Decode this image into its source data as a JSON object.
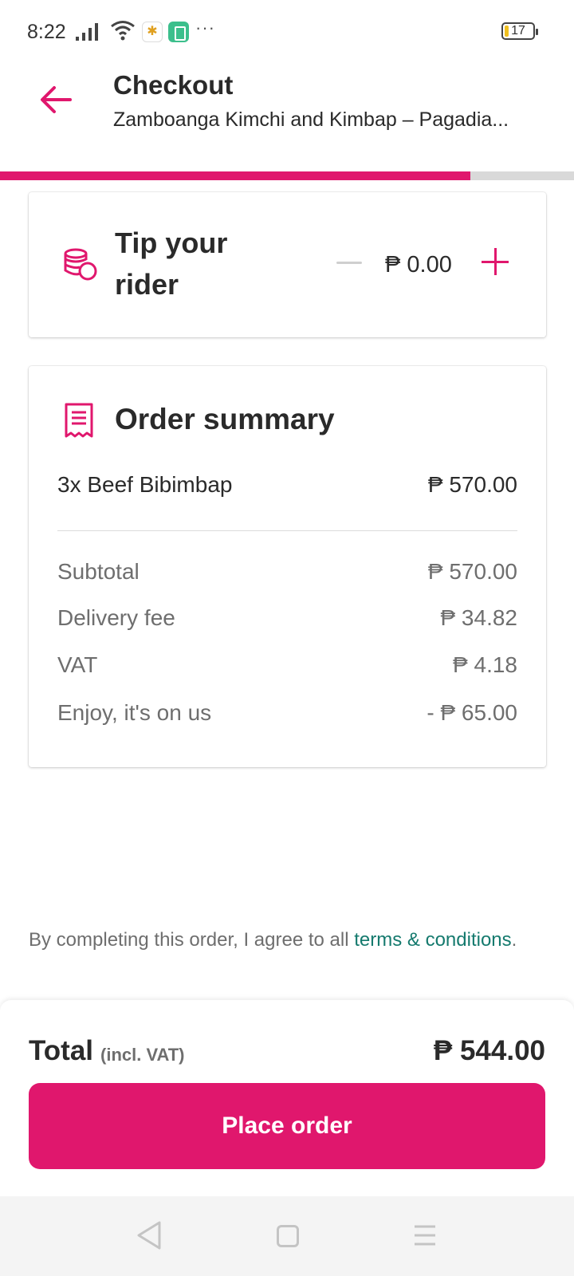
{
  "status_bar": {
    "time": "8:22",
    "more": "···",
    "battery": "17"
  },
  "header": {
    "title": "Checkout",
    "subtitle": "Zamboanga Kimchi and Kimbap – Pagadia..."
  },
  "progress": {
    "fraction": 0.82,
    "color": "#e0176d"
  },
  "tip": {
    "label": "Tip your rider",
    "amount": "₱ 0.00"
  },
  "summary": {
    "title": "Order summary",
    "items": [
      {
        "name": "3x Beef Bibimbap",
        "price": "₱ 570.00"
      }
    ],
    "fees": [
      {
        "label": "Subtotal",
        "value": "₱ 570.00"
      },
      {
        "label": "Delivery fee",
        "value": "₱ 34.82"
      },
      {
        "label": "VAT",
        "value": "₱ 4.18"
      },
      {
        "label": "Enjoy, it's on us",
        "value": "- ₱ 65.00"
      }
    ]
  },
  "terms": {
    "text": "By completing this order, I agree to all ",
    "link": "terms & conditions",
    "end": "."
  },
  "total": {
    "label": "Total",
    "note": "(incl. VAT)",
    "value": "₱ 544.00"
  },
  "place_order_label": "Place order",
  "colors": {
    "accent": "#e0176d",
    "link": "#157a6e"
  },
  "icons": {
    "back": "arrow-left-icon",
    "tip": "coins-icon",
    "summary": "receipt-icon"
  }
}
